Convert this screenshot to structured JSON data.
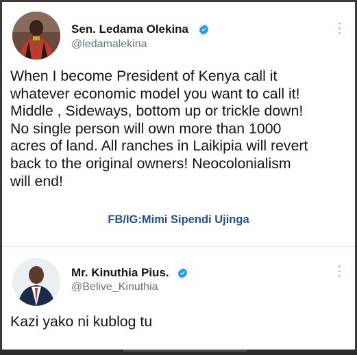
{
  "tweet1": {
    "name": "Sen. Ledama Olekina",
    "handle": "@ledamalekina",
    "text_lines": [
      "When I become President of Kenya call it",
      "whatever economic model you want to call it!",
      "Middle , Sideways, bottom up or trickle down!",
      "No single person will own more than 1000",
      "acres of land. All ranches in Laikipia will revert",
      "back to the original owners!  Neocolonialism",
      "will end!"
    ],
    "watermark": "FB/IG:Mimi Sipendi Ujinga"
  },
  "tweet2": {
    "name": "Mr. Kinuthia Pius.",
    "handle": "@Belive_Kinuthia",
    "text": "Kazi yako ni kublog tu"
  },
  "icons": {
    "verified": "verified-badge-icon",
    "more": "more-options-icon"
  },
  "colors": {
    "verified_blue": "#1d9bf0",
    "watermark_blue": "#1f4f9a",
    "text": "#0f1419",
    "muted": "#66707a"
  }
}
